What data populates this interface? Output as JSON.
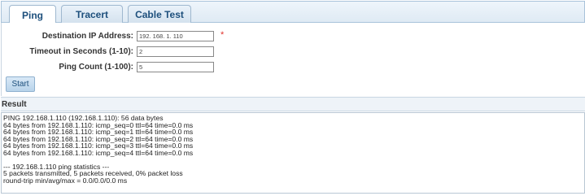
{
  "tabs": [
    {
      "label": "Ping",
      "active": true
    },
    {
      "label": "Tracert",
      "active": false
    },
    {
      "label": "Cable Test",
      "active": false
    }
  ],
  "form": {
    "destination": {
      "label": "Destination IP Address:",
      "value": "192. 168. 1. 110",
      "required_mark": "*"
    },
    "timeout": {
      "label": "Timeout in Seconds (1-10):",
      "value": "2"
    },
    "count": {
      "label": "Ping Count (1-100):",
      "value": "5"
    },
    "start_label": "Start"
  },
  "result": {
    "title": "Result",
    "lines": [
      "PING 192.168.1.110 (192.168.1.110): 56 data bytes",
      "64 bytes from 192.168.1.110: icmp_seq=0 ttl=64 time=0.0 ms",
      "64 bytes from 192.168.1.110: icmp_seq=1 ttl=64 time=0.0 ms",
      "64 bytes from 192.168.1.110: icmp_seq=2 ttl=64 time=0.0 ms",
      "64 bytes from 192.168.1.110: icmp_seq=3 ttl=64 time=0.0 ms",
      "64 bytes from 192.168.1.110: icmp_seq=4 ttl=64 time=0.0 ms",
      "",
      "--- 192.168.1.110 ping statistics ---",
      "5 packets transmitted, 5 packets received, 0% packet loss",
      "round-trip min/avg/max = 0.0/0.0/0.0 ms"
    ]
  },
  "colors": {
    "accent": "#1d4f7c",
    "required": "#e0322c",
    "tab_border": "#9fb8cf"
  }
}
